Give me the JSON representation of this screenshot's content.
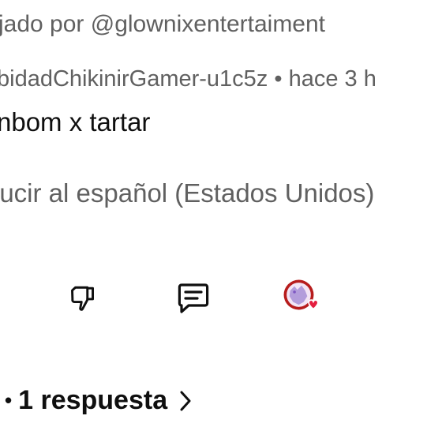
{
  "pinned": {
    "text": "jado por @glownixentertaiment"
  },
  "comment": {
    "meta": "bidadChikinirGamer-u1c5z • hace 3 h",
    "text": "nbom x tartar",
    "translate_label": "lucir al español (Estados Unidos)"
  },
  "actions": {
    "dislike_icon": "thumbs-down-icon",
    "reply_icon": "comment-icon",
    "creator_heart_icon": "creator-heart-icon"
  },
  "replies": {
    "bullet": "•",
    "label": "1 respuesta",
    "chevron_icon": "chevron-right-icon"
  },
  "colors": {
    "primary_text": "#0f0f0f",
    "secondary_text": "#606060",
    "heart": "#e41e3f",
    "avatar_bg": "#b71c1c",
    "avatar_figure": "#b39ddb"
  }
}
